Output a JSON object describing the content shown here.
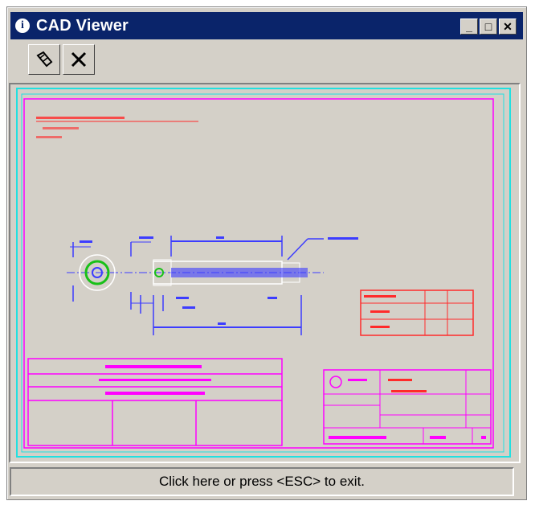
{
  "window": {
    "title": "CAD Viewer"
  },
  "title_buttons": {
    "minimize": "_",
    "maximize": "□",
    "close": "✕"
  },
  "toolbar": [
    {
      "icon": "zoom-tool-icon"
    },
    {
      "icon": "close-x-icon"
    }
  ],
  "status": {
    "text": "Click here or press <ESC> to exit."
  },
  "colors": {
    "titlebar": "#0a246a",
    "window_face": "#d4d0c8",
    "drawing_magenta": "#ff00ff",
    "drawing_red": "#ff2a2a",
    "drawing_blue": "#3c3cff",
    "drawing_cyan": "#22e0e0",
    "drawing_green": "#18c018"
  }
}
